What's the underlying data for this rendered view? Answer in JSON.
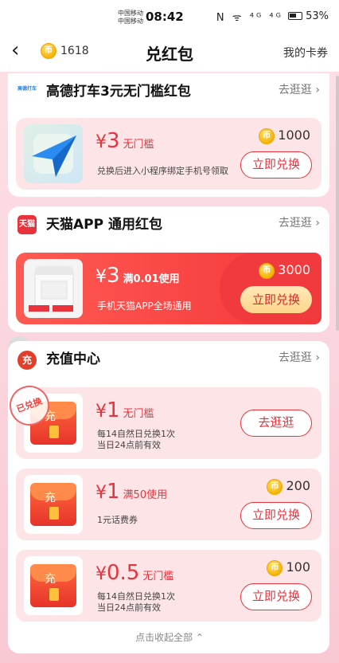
{
  "status": {
    "carrier1": "中国移动",
    "carrier2": "中国移动",
    "time": "08:42",
    "signal": "N ᯤ ⁴ᴳ ⁴ᴳ",
    "battery": "53%"
  },
  "nav": {
    "back": "‹",
    "balance": "1618",
    "title": "兑红包",
    "my_cards": "我的卡券",
    "coin_glyph": "币"
  },
  "sections": [
    {
      "name": "高德打车3元无门槛红包",
      "more": "去逛逛 ›",
      "logo": "高德打车",
      "coupons": [
        {
          "amount": "3",
          "unit": "¥",
          "cond": "无门槛",
          "desc": "兑换后进入小程序绑定手机号领取",
          "price": "1000",
          "button": "立即兑换"
        }
      ]
    },
    {
      "name": "天猫APP 通用红包",
      "more": "去逛逛 ›",
      "logo": "天猫",
      "coupons": [
        {
          "amount": "3",
          "unit": "¥",
          "cond": "满0.01使用",
          "desc": "手机天猫APP全场通用",
          "price": "3000",
          "button": "立即兑换"
        }
      ]
    },
    {
      "name": "充值中心",
      "more": "去逛逛 ›",
      "logo": "充",
      "coupons": [
        {
          "amount": "1",
          "unit": "¥",
          "cond": "无门槛",
          "line1": "每14自然日兑换1次",
          "line2": "当日24点前有效",
          "button": "去逛逛",
          "stamp": "已兑换",
          "pack_char": "充"
        },
        {
          "amount": "1",
          "unit": "¥",
          "cond": "满50使用",
          "line1": "1元话费券",
          "line2": "",
          "price": "200",
          "button": "立即兑换",
          "pack_char": "充"
        },
        {
          "amount": "0.5",
          "unit": "¥",
          "cond": "无门槛",
          "line1": "每14自然日兑换1次",
          "line2": "当日24点前有效",
          "price": "100",
          "button": "立即兑换",
          "pack_char": "充"
        }
      ]
    }
  ],
  "collapse": "点击收起全部 ⌃",
  "colors": {
    "accent": "#e8323c",
    "bg": "#fbd3dc",
    "coin": "#f5b400"
  }
}
